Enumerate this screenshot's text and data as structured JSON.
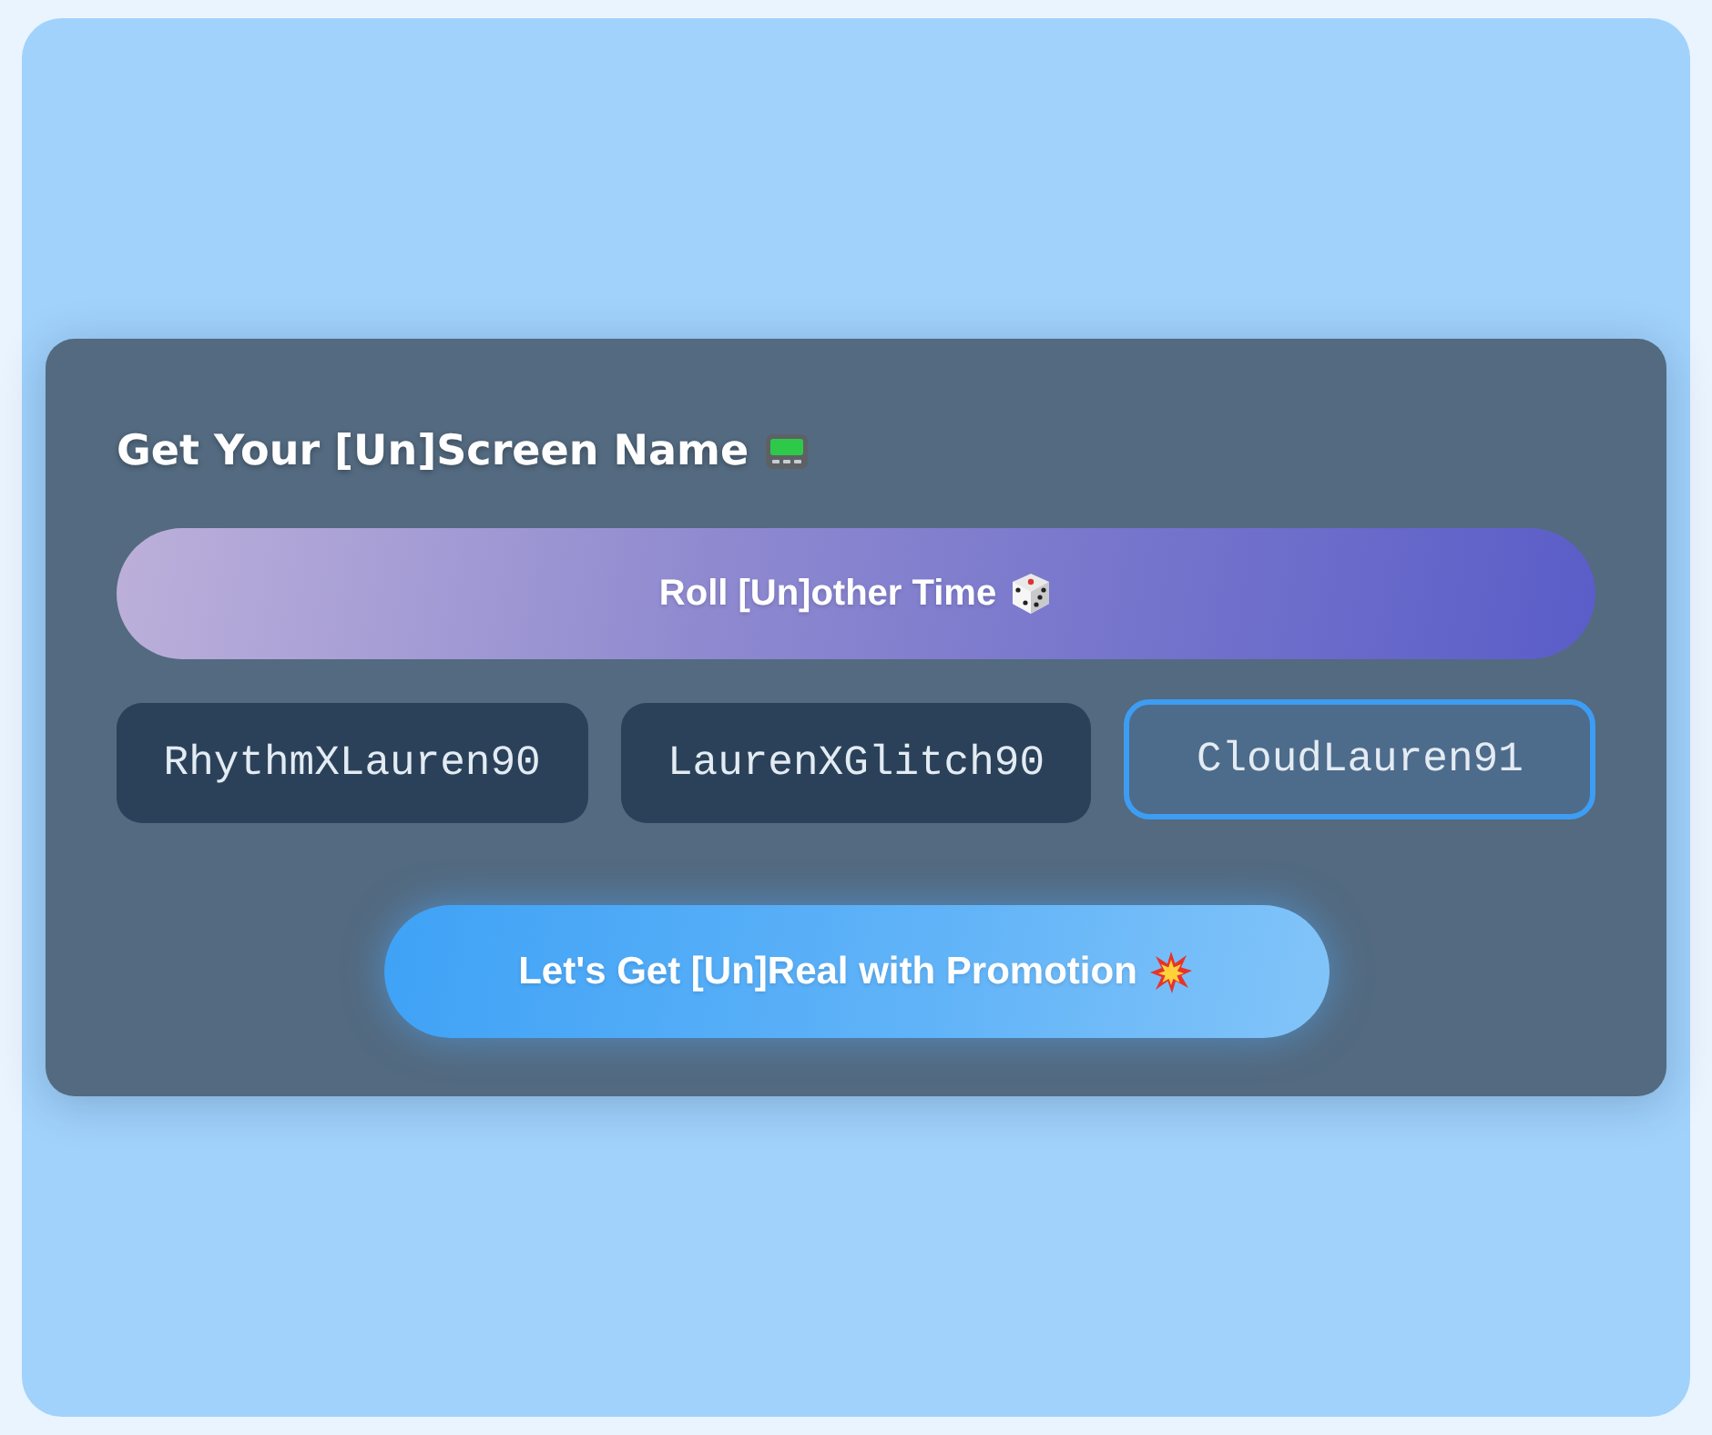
{
  "title": {
    "text": "Get Your [Un]Screen Name"
  },
  "roll_button": {
    "label": "Roll [Un]other Time"
  },
  "names": [
    {
      "label": "RhythmXLauren90",
      "selected": false
    },
    {
      "label": "LaurenXGlitch90",
      "selected": false
    },
    {
      "label": "CloudLauren91",
      "selected": true
    }
  ],
  "promo_button": {
    "label": "Let's Get [Un]Real with Promotion"
  }
}
